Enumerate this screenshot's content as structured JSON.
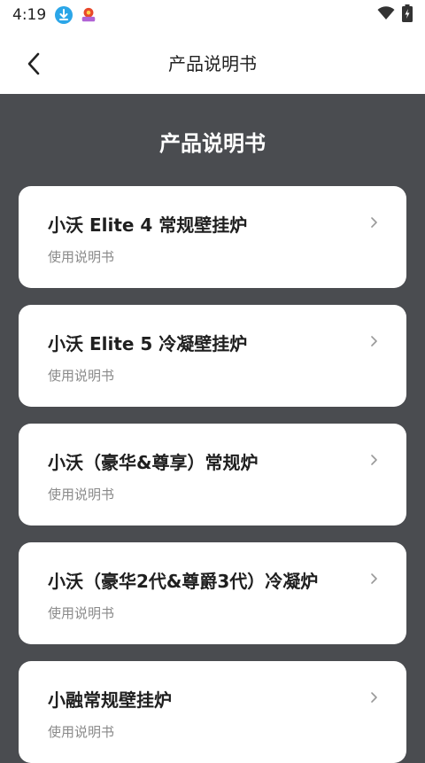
{
  "status_bar": {
    "time": "4:19",
    "icons": [
      "download-icon",
      "app-notification-icon",
      "wifi-icon",
      "battery-icon"
    ]
  },
  "app_bar": {
    "title": "产品说明书",
    "back_icon": "chevron-left-icon"
  },
  "main": {
    "section_title": "产品说明书",
    "cards": [
      {
        "title": "小沃 Elite 4 常规壁挂炉",
        "subtitle": "使用说明书"
      },
      {
        "title": "小沃 Elite 5 冷凝壁挂炉",
        "subtitle": "使用说明书"
      },
      {
        "title": "小沃（豪华&尊享）常规炉",
        "subtitle": "使用说明书"
      },
      {
        "title": "小沃（豪华2代&尊爵3代）冷凝炉",
        "subtitle": "使用说明书"
      },
      {
        "title": "小融常规壁挂炉",
        "subtitle": "使用说明书"
      }
    ]
  },
  "colors": {
    "background": "#4a4c50",
    "card": "#ffffff",
    "title_text": "#1f1f1f",
    "subtitle_text": "#8a8a8a",
    "download_badge": "#2ba6e8",
    "notification_badge": "#e8492b"
  }
}
